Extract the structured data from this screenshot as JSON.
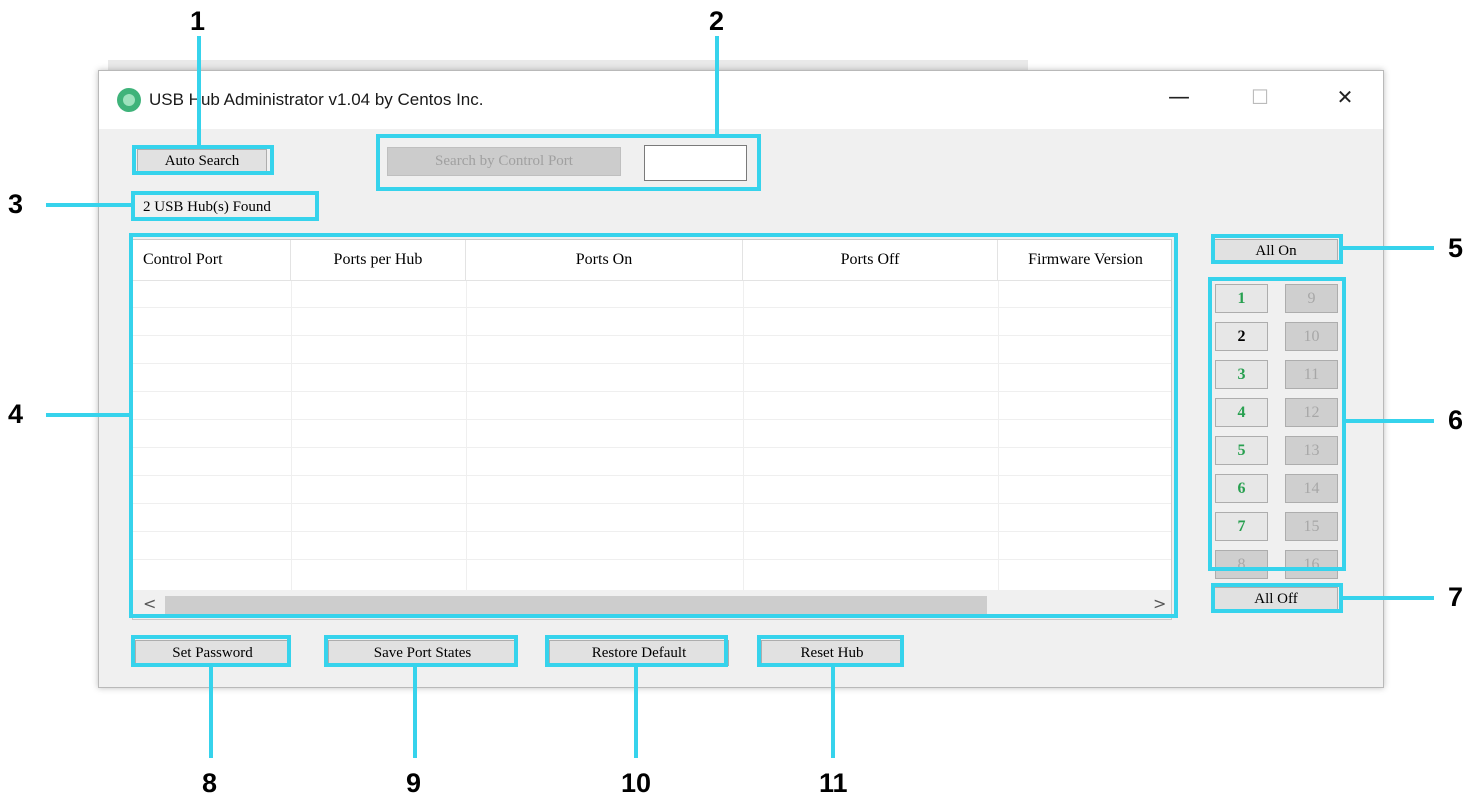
{
  "window": {
    "title": "USB Hub Administrator v1.04 by Centos Inc.",
    "minimize_glyph": "—",
    "maximize_glyph": "☐",
    "close_glyph": "✕"
  },
  "toolbar": {
    "auto_search_label": "Auto Search",
    "search_by_port_label": "Search by Control Port",
    "port_input_value": ""
  },
  "status": {
    "found_text": "2 USB Hub(s) Found"
  },
  "table": {
    "columns": [
      "Control Port",
      "Ports per Hub",
      "Ports On",
      "Ports Off",
      "Firmware Version"
    ],
    "rows": [],
    "scroll_left": "<",
    "scroll_right": ">"
  },
  "ports": {
    "all_on_label": "All On",
    "all_off_label": "All Off",
    "left": [
      {
        "label": "1",
        "state": "green"
      },
      {
        "label": "2",
        "state": "black"
      },
      {
        "label": "3",
        "state": "green"
      },
      {
        "label": "4",
        "state": "green"
      },
      {
        "label": "5",
        "state": "green"
      },
      {
        "label": "6",
        "state": "green"
      },
      {
        "label": "7",
        "state": "green"
      },
      {
        "label": "8",
        "state": "off"
      }
    ],
    "right": [
      {
        "label": "9",
        "state": "off"
      },
      {
        "label": "10",
        "state": "off"
      },
      {
        "label": "11",
        "state": "off"
      },
      {
        "label": "12",
        "state": "off"
      },
      {
        "label": "13",
        "state": "off"
      },
      {
        "label": "14",
        "state": "off"
      },
      {
        "label": "15",
        "state": "off"
      },
      {
        "label": "16",
        "state": "off"
      }
    ]
  },
  "bottom": {
    "set_password_label": "Set Password",
    "save_port_states_label": "Save Port States",
    "restore_default_label": "Restore Default",
    "reset_hub_label": "Reset Hub"
  },
  "callouts": [
    "1",
    "2",
    "3",
    "4",
    "5",
    "6",
    "7",
    "8",
    "9",
    "10",
    "11"
  ],
  "colors": {
    "callout": "#36d3ec",
    "port_on": "#28a050",
    "port_off": "#a7a7a7"
  }
}
